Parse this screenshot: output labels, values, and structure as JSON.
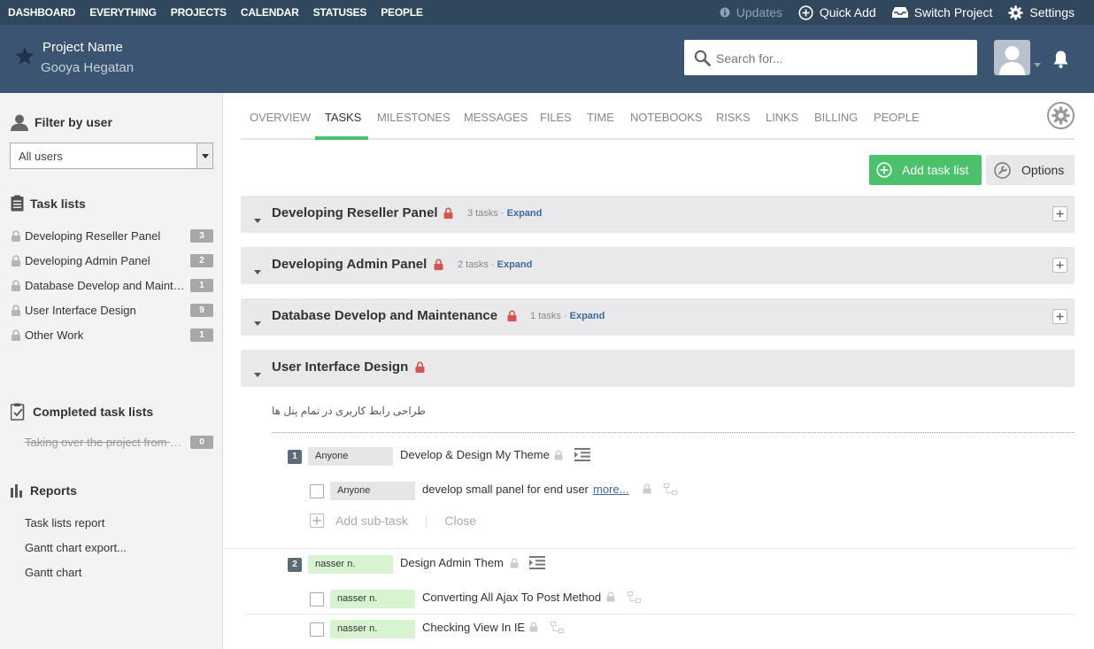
{
  "topnav": {
    "items": [
      "DASHBOARD",
      "EVERYTHING",
      "PROJECTS",
      "CALENDAR",
      "STATUSES",
      "PEOPLE"
    ],
    "updates": "Updates",
    "quick_add": "Quick Add",
    "switch_project": "Switch Project",
    "settings": "Settings"
  },
  "header": {
    "project_name": "Project Name",
    "company": "Gooya Hegatan",
    "search_placeholder": "Search for..."
  },
  "sidebar": {
    "filter_title": "Filter by user",
    "filter_value": "All users",
    "tasklists_title": "Task lists",
    "tasklists": [
      {
        "label": "Developing Reseller Panel",
        "count": "3"
      },
      {
        "label": "Developing Admin Panel",
        "count": "2"
      },
      {
        "label": "Database Develop and Maintenance",
        "count": "1"
      },
      {
        "label": "User Interface Design",
        "count": "9"
      },
      {
        "label": "Other Work",
        "count": "1"
      }
    ],
    "completed_title": "Completed task lists",
    "completed": [
      {
        "label": "Taking over the project from previous team",
        "count": "0"
      }
    ],
    "reports_title": "Reports",
    "reports": [
      "Task lists report",
      "Gantt chart export...",
      "Gantt chart"
    ]
  },
  "tabs": [
    "OVERVIEW",
    "TASKS",
    "MILESTONES",
    "MESSAGES",
    "FILES",
    "TIME",
    "NOTEBOOKS",
    "RISKS",
    "LINKS",
    "BILLING",
    "PEOPLE"
  ],
  "active_tab": "TASKS",
  "buttons": {
    "add_task_list": "Add task list",
    "options": "Options"
  },
  "task_lists": [
    {
      "name": "Developing Reseller Panel",
      "meta": "3 tasks · ",
      "expand": "Expand"
    },
    {
      "name": "Developing Admin Panel",
      "meta": "2 tasks · ",
      "expand": "Expand"
    },
    {
      "name": "Database Develop and Maintenance",
      "meta": "1 tasks · ",
      "expand": "Expand"
    },
    {
      "name": "User Interface Design"
    }
  ],
  "expanded_list": {
    "description": "طراحی رابط کاربری در تمام پنل ها",
    "tasks": [
      {
        "num": "1",
        "assignee": "Anyone",
        "text": "Develop & Design My Theme",
        "subtasks": [
          {
            "assignee": "Anyone",
            "text": "develop small panel for end user",
            "more": "more..."
          }
        ]
      },
      {
        "num": "2",
        "assignee": "nasser n.",
        "text": "Design Admin Them",
        "subtasks": [
          {
            "assignee": "nasser n.",
            "text": "Converting All Ajax To Post Method"
          },
          {
            "assignee": "nasser n.",
            "text": "Checking View In IE"
          }
        ]
      }
    ],
    "add_subtask": "Add sub-task",
    "close": "Close"
  },
  "colors": {
    "nav_bg": "#30475e",
    "header_bg": "#3a5471",
    "accent_green": "#4cc16b",
    "lock_red": "#d9534f"
  }
}
